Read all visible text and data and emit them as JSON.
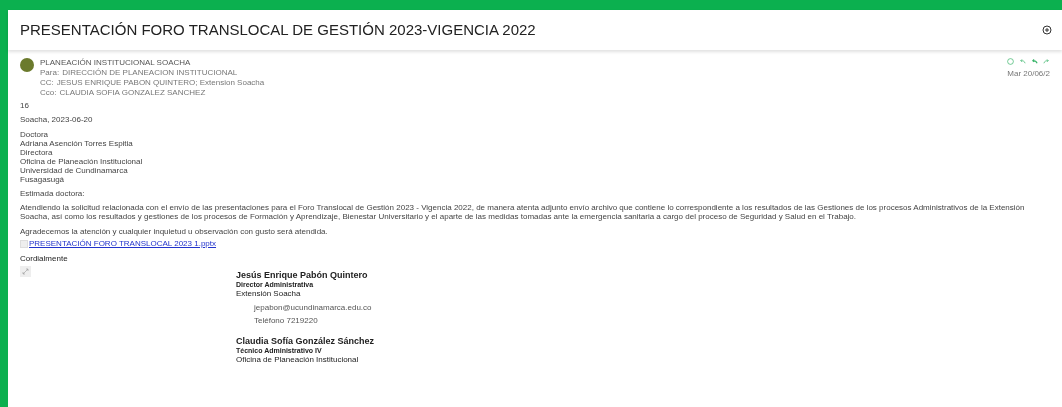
{
  "subject": "PRESENTACIÓN FORO TRANSLOCAL DE GESTIÓN 2023-VIGENCIA 2022",
  "sender": {
    "name": "PLANEACIÓN INSTITUCIONAL SOACHA",
    "date": "Mar 20/06/2",
    "recipients": [
      {
        "label": "Para:",
        "value": "DIRECCIÓN DE PLANEACION INSTITUCIONAL"
      },
      {
        "label": "CC:",
        "value": "JESUS ENRIQUE PABON QUINTERO;  Extension Soacha"
      },
      {
        "label": "Cco:",
        "value": "CLAUDIA SOFIA GONZALEZ SANCHEZ"
      }
    ]
  },
  "body": {
    "number": "16",
    "place_date": "Soacha, 2023-06-20",
    "addressee": [
      "Doctora",
      "Adriana Asención Torres Espitia",
      "Directora",
      "Oficina de Planeación Institucional",
      "Universidad de Cundinamarca",
      "Fusagasugá"
    ],
    "greeting": "Estimada doctora:",
    "paragraph": "Atendiendo la solicitud relacionada con el envío de las presentaciones para el Foro Translocal de Gestión 2023 - Vigencia 2022, de manera atenta adjunto envío archivo que contiene lo correspondiente a los resultados de las Gestiones de los procesos Administrativos de la Extensión Soacha, así como los resultados y gestiones de los procesos de Formación y Aprendizaje, Bienestar Universitario y el aparte de las medidas tomadas ante la emergencia sanitaria a cargo del proceso de Seguridad y Salud en el Trabajo.",
    "thanks": "Agradecemos la atención y cualquier inquietud u observación con gusto será atendida.",
    "attachment": "PRESENTACIÓN FORO TRANSLOCAL 2023 1.pptx",
    "closing": "Cordialmente"
  },
  "signatures": [
    {
      "name": "Jesús Enrique Pabón Quintero",
      "role": "Director Administrativa",
      "office": "Extensión Soacha",
      "details": [
        "jepabon@ucundinamarca.edu.co",
        "Teléfono 7219220"
      ]
    },
    {
      "name": "Claudia Sofía González Sánchez",
      "role": "Técnico Administrativo IV",
      "office": "Oficina de Planeación Institucional"
    }
  ]
}
